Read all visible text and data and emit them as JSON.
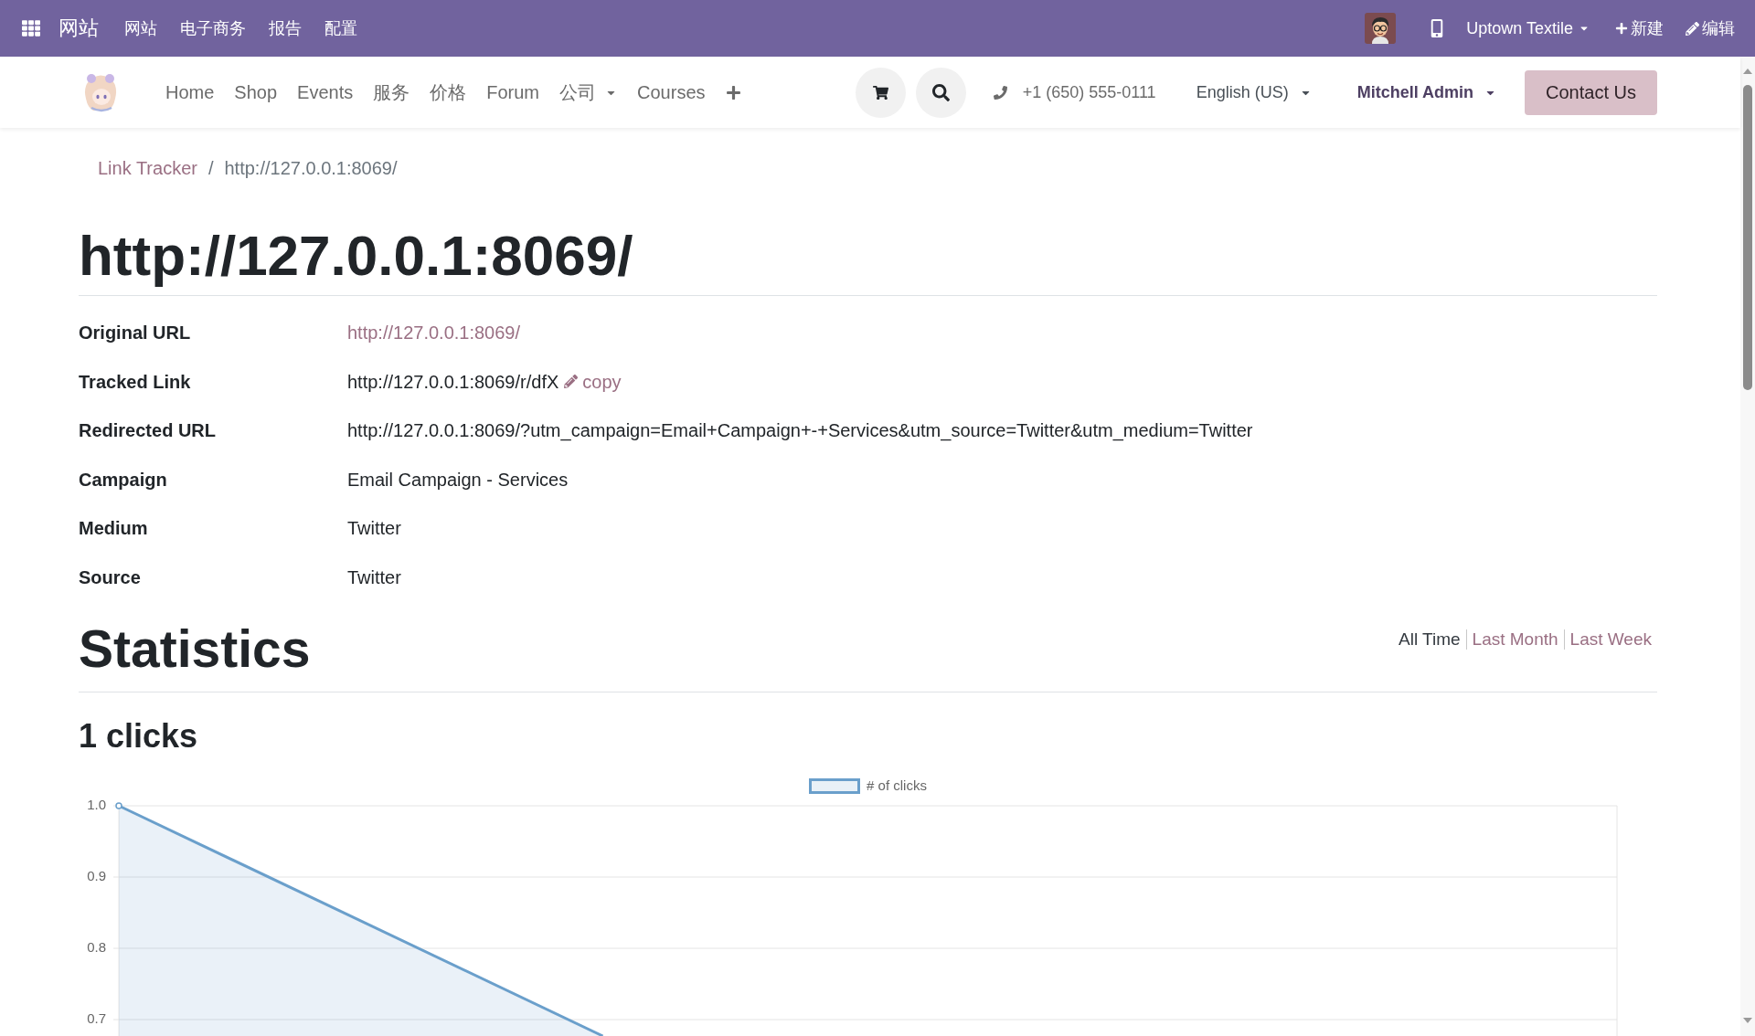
{
  "top_bar": {
    "app_title": "网站",
    "menu": [
      "网站",
      "电子商务",
      "报告",
      "配置"
    ],
    "company": "Uptown Textile",
    "new_button": "新建",
    "edit_button": "编辑"
  },
  "navbar": {
    "menu": [
      {
        "label": "Home",
        "dropdown": false
      },
      {
        "label": "Shop",
        "dropdown": false
      },
      {
        "label": "Events",
        "dropdown": false
      },
      {
        "label": "服务",
        "dropdown": false
      },
      {
        "label": "价格",
        "dropdown": false
      },
      {
        "label": "Forum",
        "dropdown": false
      },
      {
        "label": "公司",
        "dropdown": true
      },
      {
        "label": "Courses",
        "dropdown": false
      }
    ],
    "phone": "+1 (650) 555-0111",
    "language": "English (US)",
    "user": "Mitchell Admin",
    "contact_button": "Contact Us"
  },
  "breadcrumb": [
    {
      "label": "Link Tracker",
      "kind": "link"
    },
    {
      "label": "/",
      "kind": "separator"
    },
    {
      "label": "http://127.0.0.1:8069/",
      "kind": "current"
    }
  ],
  "title": "http://127.0.0.1:8069/",
  "fields": [
    {
      "label": "Original URL",
      "value": "http://127.0.0.1:8069/",
      "kind": "link"
    },
    {
      "label": "Tracked Link",
      "value": "http://127.0.0.1:8069/r/dfX",
      "kind": "copy",
      "action": "copy"
    },
    {
      "label": "Redirected URL",
      "value": "http://127.0.0.1:8069/?utm_campaign=Email+Campaign+-+Services&utm_source=Twitter&utm_medium=Twitter",
      "kind": "text"
    },
    {
      "label": "Campaign",
      "value": "Email Campaign - Services",
      "kind": "text"
    },
    {
      "label": "Medium",
      "value": "Twitter",
      "kind": "text"
    },
    {
      "label": "Source",
      "value": "Twitter",
      "kind": "text"
    }
  ],
  "statistics": {
    "title": "Statistics",
    "periods": [
      {
        "label": "All Time",
        "selected": true
      },
      {
        "label": "Last Month",
        "selected": false
      },
      {
        "label": "Last Week",
        "selected": false
      }
    ],
    "total": "1 clicks",
    "chart": {
      "legend": "# of clicks",
      "y_labels": [
        "1.0",
        "0.9",
        "0.8",
        "0.7"
      ]
    }
  }
}
